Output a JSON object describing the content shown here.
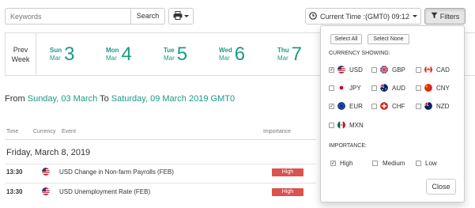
{
  "toolbar": {
    "search_placeholder": "Keywords",
    "search_label": "Search",
    "time_label": "Current Time :(GMT0) 09:12",
    "filters_label": "Filters"
  },
  "week": {
    "prev_label_line1": "Prev",
    "prev_label_line2": "Week",
    "days": [
      {
        "name": "Sun",
        "month": "Mar",
        "num": "3"
      },
      {
        "name": "Mon",
        "month": "Mar",
        "num": "4"
      },
      {
        "name": "Tue",
        "month": "Mar",
        "num": "5"
      },
      {
        "name": "Wed",
        "month": "Mar",
        "num": "6"
      },
      {
        "name": "Thu",
        "month": "Mar",
        "num": "7"
      }
    ]
  },
  "range": {
    "from_label": "From",
    "from_date": "Sunday, 03 March",
    "to_label": "To",
    "to_date": "Saturday, 09 March 2019 GMT0"
  },
  "table": {
    "col_time": "Time",
    "col_currency": "Currency",
    "col_event": "Event",
    "col_importance": "Importance",
    "date_heading": "Friday, March 8, 2019",
    "rows": [
      {
        "time": "13:30",
        "currency_flag": "us-flag-icon",
        "event": "USD Change in Non-farm Payrolls (FEB)",
        "importance": "High"
      },
      {
        "time": "13:30",
        "currency_flag": "us-flag-icon",
        "event": "USD Unemployment Rate (FEB)",
        "importance": "High"
      }
    ]
  },
  "filters": {
    "select_all": "Select All",
    "select_none": "Select None",
    "currency_heading": "CURRENCY SHOWING:",
    "currencies": [
      {
        "code": "USD",
        "checked": true,
        "flag": "us-flag-icon"
      },
      {
        "code": "GBP",
        "checked": false,
        "flag": "uk-flag-icon"
      },
      {
        "code": "CAD",
        "checked": false,
        "flag": "canada-flag-icon"
      },
      {
        "code": "JPY",
        "checked": false,
        "flag": "japan-flag-icon"
      },
      {
        "code": "AUD",
        "checked": false,
        "flag": "australia-flag-icon"
      },
      {
        "code": "CNY",
        "checked": false,
        "flag": "china-flag-icon"
      },
      {
        "code": "EUR",
        "checked": true,
        "flag": "eu-flag-icon"
      },
      {
        "code": "CHF",
        "checked": false,
        "flag": "swiss-flag-icon"
      },
      {
        "code": "NZD",
        "checked": false,
        "flag": "nz-flag-icon"
      },
      {
        "code": "MXN",
        "checked": false,
        "flag": "mexico-flag-icon"
      }
    ],
    "importance_heading": "IMPORTANCE:",
    "importance": [
      {
        "label": "High",
        "checked": true
      },
      {
        "label": "Medium",
        "checked": false
      },
      {
        "label": "Low",
        "checked": false
      }
    ],
    "close_label": "Close"
  },
  "colors": {
    "accent": "#1a9b84",
    "high_badge": "#d9534f"
  }
}
